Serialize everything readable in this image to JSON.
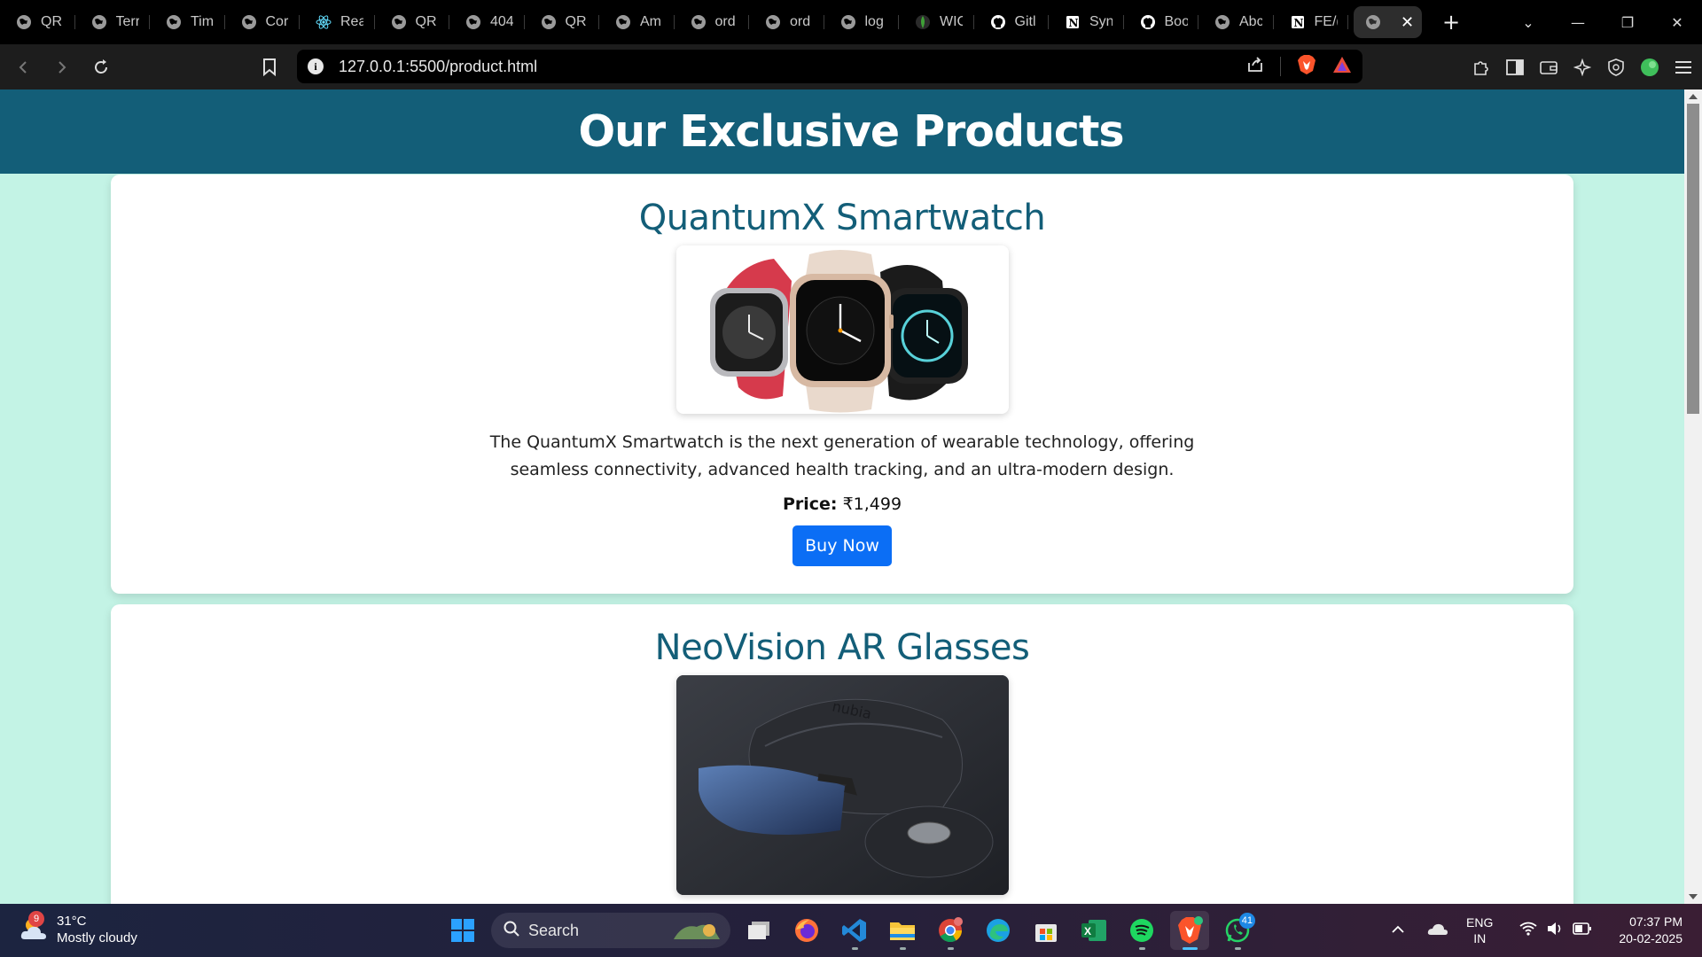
{
  "browser": {
    "tabs": [
      {
        "title": "QR",
        "icon": "globe-icon"
      },
      {
        "title": "Terr",
        "icon": "globe-icon"
      },
      {
        "title": "Tim",
        "icon": "globe-icon"
      },
      {
        "title": "Cor",
        "icon": "globe-icon"
      },
      {
        "title": "Rea",
        "icon": "react-icon"
      },
      {
        "title": "QR",
        "icon": "globe-icon"
      },
      {
        "title": "404",
        "icon": "globe-icon"
      },
      {
        "title": "QR",
        "icon": "globe-icon"
      },
      {
        "title": "Am",
        "icon": "globe-icon"
      },
      {
        "title": "ord",
        "icon": "globe-icon"
      },
      {
        "title": "ord",
        "icon": "globe-icon"
      },
      {
        "title": "log",
        "icon": "globe-icon"
      },
      {
        "title": "WIC",
        "icon": "mongodb-icon"
      },
      {
        "title": "Gitl",
        "icon": "github-icon"
      },
      {
        "title": "Syn",
        "icon": "notion-icon"
      },
      {
        "title": "Boo",
        "icon": "github-icon"
      },
      {
        "title": "Abc",
        "icon": "globe-icon"
      },
      {
        "title": "FE/(",
        "icon": "notion-icon"
      }
    ],
    "active_tab_icon": "globe-icon",
    "url": "127.0.0.1:5500/product.html"
  },
  "page": {
    "header_title": "Our Exclusive Products",
    "products": [
      {
        "name": "QuantumX Smartwatch",
        "image": "smartwatch-image",
        "description": "The QuantumX Smartwatch is the next generation of wearable technology, offering seamless connectivity, advanced health tracking, and an ultra-modern design.",
        "price_label": "Price:",
        "price": "₹1,499",
        "button": "Buy Now"
      },
      {
        "name": "NeoVision AR Glasses",
        "image": "ar-glasses-image",
        "image_text": "nubia"
      }
    ]
  },
  "taskbar": {
    "weather": {
      "badge": "9",
      "temp": "31°C",
      "condition": "Mostly cloudy"
    },
    "search_placeholder": "Search",
    "whatsapp_badge": "41",
    "language": {
      "line1": "ENG",
      "line2": "IN"
    },
    "clock": {
      "time": "07:37 PM",
      "date": "20-02-2025"
    }
  }
}
